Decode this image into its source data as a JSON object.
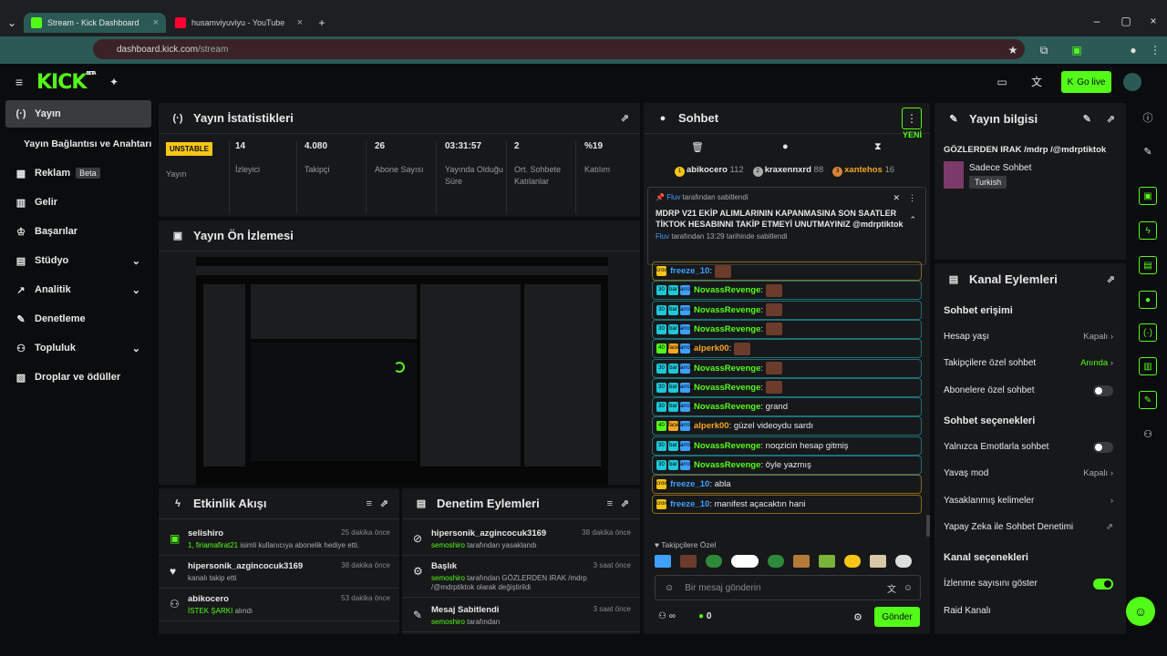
{
  "browser": {
    "tabs": [
      {
        "label": "Stream - Kick Dashboard"
      },
      {
        "label": "husamviyuviyu - YouTube"
      }
    ],
    "url_host": "dashboard.kick.com",
    "url_path": "/stream"
  },
  "topbar": {
    "logo": "KICK",
    "logo_badge": "BETA",
    "go_live": "Go live"
  },
  "sidebar": {
    "items": [
      {
        "label": "Yayın",
        "icon": "broadcast-icon"
      },
      {
        "label": "Yayın Bağlantısı ve Anahtarı"
      },
      {
        "label": "Reklam",
        "badge": "Beta",
        "icon": "calendar-icon"
      },
      {
        "label": "Gelir",
        "icon": "chart-icon"
      },
      {
        "label": "Başarılar",
        "icon": "trophy-icon"
      },
      {
        "label": "Stüdyo",
        "icon": "studio-icon"
      },
      {
        "label": "Analitik",
        "icon": "analytics-icon"
      },
      {
        "label": "Denetleme",
        "icon": "wrench-icon"
      },
      {
        "label": "Topluluk",
        "icon": "community-icon"
      },
      {
        "label": "Droplar ve ödüller",
        "icon": "gift-icon"
      }
    ]
  },
  "stats": {
    "title": "Yayın İstatistikleri",
    "items": [
      {
        "value": "UNSTABLE",
        "label": "Yayın"
      },
      {
        "value": "14",
        "label": "İzleyici"
      },
      {
        "value": "4.080",
        "label": "Takipçi"
      },
      {
        "value": "26",
        "label": "Abone Sayısı"
      },
      {
        "value": "03:31:57",
        "label": "Yayında Olduğu Süre"
      },
      {
        "value": "2",
        "label": "Ort. Sohbete Katılanlar"
      },
      {
        "value": "%19",
        "label": "Katılım"
      }
    ]
  },
  "preview": {
    "title": "Yayın Ön İzlemesi"
  },
  "activity": {
    "title": "Etkinlik Akışı",
    "items": [
      {
        "name": "selishiro",
        "time": "25 dakika önce",
        "highlight": "1, firiamafirat21",
        "sub": " isimli kullanıcıya abonelik hediye etti."
      },
      {
        "name": "hipersonik_azgincocuk3169",
        "time": "38 dakika önce",
        "highlight": "",
        "sub": "kanalı takip etti"
      },
      {
        "name": "abikocero",
        "time": "53 dakika önce",
        "highlight": "İSTEK ŞARKI",
        "sub": " alındı"
      }
    ]
  },
  "moderation": {
    "title": "Denetim Eylemleri",
    "items": [
      {
        "name": "hipersonik_azgincocuk3169",
        "time": "38 dakika önce",
        "highlight": "semoshiro",
        "sub": " tarafından yasaklandı"
      },
      {
        "name": "Başlık",
        "time": "3 saat önce",
        "highlight": "semoshiro",
        "sub": " tarafından GÖZLERDEN IRAK /mdrp /@mdrptiktok olarak değiştirildi"
      },
      {
        "name": "Mesaj Sabitlendi",
        "time": "3 saat önce",
        "highlight": "semoshiro",
        "sub": " tarafından"
      }
    ]
  },
  "chat": {
    "title": "Sohbet",
    "new_label": "YENİ",
    "top": [
      {
        "rank": "1",
        "name": "abikocero",
        "count": "112"
      },
      {
        "rank": "2",
        "name": "kraxennxrd",
        "count": "88"
      },
      {
        "rank": "3",
        "name": "xantehos",
        "count": "16"
      }
    ],
    "pinned": {
      "by": "Fluv",
      "by_suffix": " tarafından sabitlendi",
      "text": "MDRP V21 EKİP ALIMLARININ KAPANMASINA SON SAATLER TİKTOK HESABINNI TAKİP ETMEYİ UNUTMAYINIZ @mdrptiktok",
      "footer_name": "Fluv",
      "footer": " tarafından 13:29 tarihinde sabitlendi"
    },
    "messages": [
      {
        "user": "freeze_10",
        "text": "",
        "emote": true,
        "gold": true,
        "color": "#3ea0ff",
        "badges": [
          "crown"
        ]
      },
      {
        "user": "NovassRevenge",
        "text": "",
        "emote": true,
        "gold": false,
        "color": "#53fc18",
        "badges": [
          "30",
          "bar",
          "arrow"
        ]
      },
      {
        "user": "NovassRevenge",
        "text": "",
        "emote": true,
        "gold": false,
        "color": "#53fc18",
        "badges": [
          "30",
          "bar",
          "arrow"
        ]
      },
      {
        "user": "NovassRevenge",
        "text": "",
        "emote": true,
        "gold": false,
        "color": "#53fc18",
        "badges": [
          "30",
          "bar",
          "arrow"
        ]
      },
      {
        "user": "alperk00",
        "text": "",
        "emote": true,
        "gold": false,
        "color": "#f5a623",
        "badges": [
          "40",
          "face",
          "arrow"
        ]
      },
      {
        "user": "NovassRevenge",
        "text": "",
        "emote": true,
        "gold": false,
        "color": "#53fc18",
        "badges": [
          "30",
          "bar",
          "arrow"
        ]
      },
      {
        "user": "NovassRevenge",
        "text": "",
        "emote": true,
        "gold": false,
        "color": "#53fc18",
        "badges": [
          "30",
          "bar",
          "arrow"
        ]
      },
      {
        "user": "NovassRevenge",
        "text": ": grand",
        "emote": false,
        "gold": false,
        "color": "#53fc18",
        "badges": [
          "30",
          "bar",
          "arrow"
        ]
      },
      {
        "user": "alperk00",
        "text": ": güzel videoydu sardı",
        "emote": false,
        "gold": false,
        "color": "#f5a623",
        "badges": [
          "40",
          "face",
          "arrow"
        ]
      },
      {
        "user": "NovassRevenge",
        "text": ": noqzicin hesap gitmiş",
        "emote": false,
        "gold": false,
        "color": "#53fc18",
        "badges": [
          "30",
          "bar",
          "arrow"
        ]
      },
      {
        "user": "NovassRevenge",
        "text": ": öyle yazmış",
        "emote": false,
        "gold": false,
        "color": "#53fc18",
        "badges": [
          "30",
          "bar",
          "arrow"
        ]
      },
      {
        "user": "freeze_10",
        "text": ": abla",
        "emote": false,
        "gold": true,
        "color": "#3ea0ff",
        "badges": [
          "crown"
        ]
      },
      {
        "user": "freeze_10",
        "text": ": manifest açacaktın hani",
        "emote": false,
        "gold": true,
        "color": "#3ea0ff",
        "badges": [
          "crown"
        ]
      }
    ],
    "followers_only": "Takipçilere Özel",
    "input_placeholder": "Bir mesaj gönderin",
    "viewers": "∞",
    "kicks": "0",
    "send": "Gönder"
  },
  "stream_info": {
    "title": "Yayın bilgisi",
    "stream_title": "GÖZLERDEN IRAK /mdrp /@mdrptiktok",
    "category": "Sadece Sohbet",
    "language": "Turkish"
  },
  "channel_actions": {
    "title": "Kanal Eylemleri",
    "sections": [
      {
        "heading": "Sohbet erişimi"
      },
      {
        "heading": "Sohbet seçenekleri"
      },
      {
        "heading": "Kanal seçenekleri"
      }
    ],
    "rows": [
      {
        "label": "Hesap yaşı",
        "value": "Kapalı",
        "green": false
      },
      {
        "label": "Takipçilere özel sohbet",
        "value": "Anında",
        "green": true
      },
      {
        "label": "Abonelere özel sohbet",
        "value": "",
        "green": false
      },
      {
        "label": "Yalnızca Emotlarla sohbet",
        "value": "",
        "green": false
      },
      {
        "label": "Yavaş mod",
        "value": "Kapalı",
        "green": false
      },
      {
        "label": "Yasaklanmış kelimeler",
        "value": "",
        "green": false
      },
      {
        "label": "Yapay Zeka ile Sohbet Denetimi",
        "value": "",
        "green": false
      },
      {
        "label": "İzlenme sayısını göster",
        "value": "",
        "green": false
      },
      {
        "label": "Raid Kanalı",
        "value": "",
        "green": false
      }
    ]
  },
  "colors": {
    "accent": "#53fc18",
    "panel": "#17181a",
    "teal": "#2b5a56"
  }
}
